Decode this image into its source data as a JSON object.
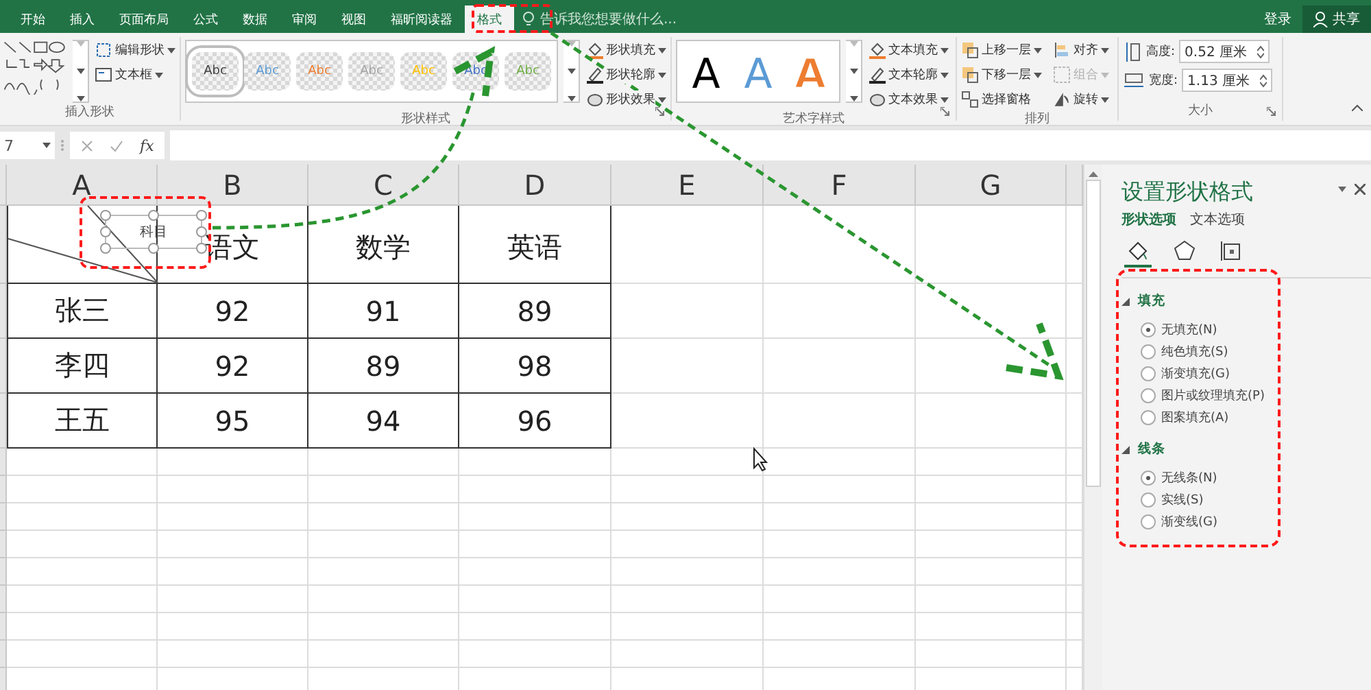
{
  "ribbon_tabs": [
    {
      "label": "开始",
      "selected": false
    },
    {
      "label": "插入",
      "selected": false
    },
    {
      "label": "页面布局",
      "selected": false
    },
    {
      "label": "公式",
      "selected": false
    },
    {
      "label": "数据",
      "selected": false
    },
    {
      "label": "审阅",
      "selected": false
    },
    {
      "label": "视图",
      "selected": false
    },
    {
      "label": "福昕阅读器",
      "selected": false
    },
    {
      "label": "格式",
      "selected": true
    }
  ],
  "tell_me": {
    "placeholder": "告诉我您想要做什么..."
  },
  "account": {
    "sign_in": "登录",
    "share": "共享"
  },
  "insert_shapes": {
    "title": "插入形状",
    "buttons": [
      {
        "kind": "edit",
        "label": "编辑形状"
      },
      {
        "kind": "textbox",
        "label": "文本框"
      }
    ]
  },
  "shape_styles": {
    "title": "形状样式",
    "presets": [
      {
        "label": "Abc",
        "color": "#404040",
        "selected": true
      },
      {
        "label": "Abc",
        "color": "#5b9bd5",
        "selected": false
      },
      {
        "label": "Abc",
        "color": "#ed7d31",
        "selected": false
      },
      {
        "label": "Abc",
        "color": "#a5a5a5",
        "selected": false
      },
      {
        "label": "Abc",
        "color": "#ffc000",
        "selected": false
      },
      {
        "label": "Abc",
        "color": "#4472c4",
        "selected": false
      },
      {
        "label": "Abc",
        "color": "#70ad47",
        "selected": false
      }
    ],
    "buttons": [
      {
        "kind": "fill",
        "label": "形状填充"
      },
      {
        "kind": "outline",
        "label": "形状轮廓"
      },
      {
        "kind": "effects",
        "label": "形状效果"
      }
    ]
  },
  "wordart_styles": {
    "title": "艺术字样式",
    "presets": [
      {
        "label": "A",
        "color": "#000000",
        "kind": "solid"
      },
      {
        "label": "A",
        "color": "#5b9bd5",
        "kind": "solid"
      },
      {
        "label": "A",
        "color": "#ed7d31",
        "kind": "outline"
      }
    ],
    "buttons": [
      {
        "kind": "fill",
        "label": "文本填充"
      },
      {
        "kind": "outline",
        "label": "文本轮廓"
      },
      {
        "kind": "effects",
        "label": "文本效果"
      }
    ]
  },
  "arrange": {
    "title": "排列",
    "buttons": [
      {
        "kind": "forward",
        "label": "上移一层",
        "disabled": false,
        "dropdown": true
      },
      {
        "kind": "backward",
        "label": "下移一层",
        "disabled": false,
        "dropdown": true
      },
      {
        "kind": "pane",
        "label": "选择窗格",
        "disabled": false,
        "dropdown": false
      },
      {
        "kind": "align",
        "label": "对齐",
        "disabled": false,
        "dropdown": true
      },
      {
        "kind": "group",
        "label": "组合",
        "disabled": true,
        "dropdown": true
      },
      {
        "kind": "rotate",
        "label": "旋转",
        "disabled": false,
        "dropdown": true
      }
    ]
  },
  "size": {
    "title": "大小",
    "fields": [
      {
        "kind": "height",
        "label": "高度:",
        "value": "0.52 厘米"
      },
      {
        "kind": "width",
        "label": "宽度:",
        "value": "1.13 厘米"
      }
    ]
  },
  "formula_bar": {
    "name_box": "7",
    "function_label": "fx"
  },
  "sheet": {
    "columns": [
      "A",
      "B",
      "C",
      "D",
      "E",
      "F",
      "G"
    ],
    "shape_text": "科目",
    "subjects": [
      "语文",
      "数学",
      "英语"
    ],
    "rows": [
      {
        "name": "张三",
        "scores": [
          "92",
          "91",
          "89"
        ]
      },
      {
        "name": "李四",
        "scores": [
          "92",
          "89",
          "98"
        ]
      },
      {
        "name": "王五",
        "scores": [
          "95",
          "94",
          "96"
        ]
      }
    ]
  },
  "format_pane": {
    "title": "设置形状格式",
    "tabs": [
      {
        "label": "形状选项",
        "selected": true
      },
      {
        "label": "文本选项",
        "selected": false
      }
    ],
    "icon_tabs": [
      {
        "kind": "fill",
        "selected": true
      },
      {
        "kind": "effects",
        "selected": false
      },
      {
        "kind": "size",
        "selected": false
      }
    ],
    "sections": [
      {
        "title": "填充",
        "expanded": true,
        "options": [
          {
            "label": "无填充(N)",
            "selected": true
          },
          {
            "label": "纯色填充(S)",
            "selected": false
          },
          {
            "label": "渐变填充(G)",
            "selected": false
          },
          {
            "label": "图片或纹理填充(P)",
            "selected": false
          },
          {
            "label": "图案填充(A)",
            "selected": false
          }
        ]
      },
      {
        "title": "线条",
        "expanded": true,
        "options": [
          {
            "label": "无线条(N)",
            "selected": true
          },
          {
            "label": "实线(S)",
            "selected": false
          },
          {
            "label": "渐变线(G)",
            "selected": false
          }
        ]
      }
    ]
  }
}
